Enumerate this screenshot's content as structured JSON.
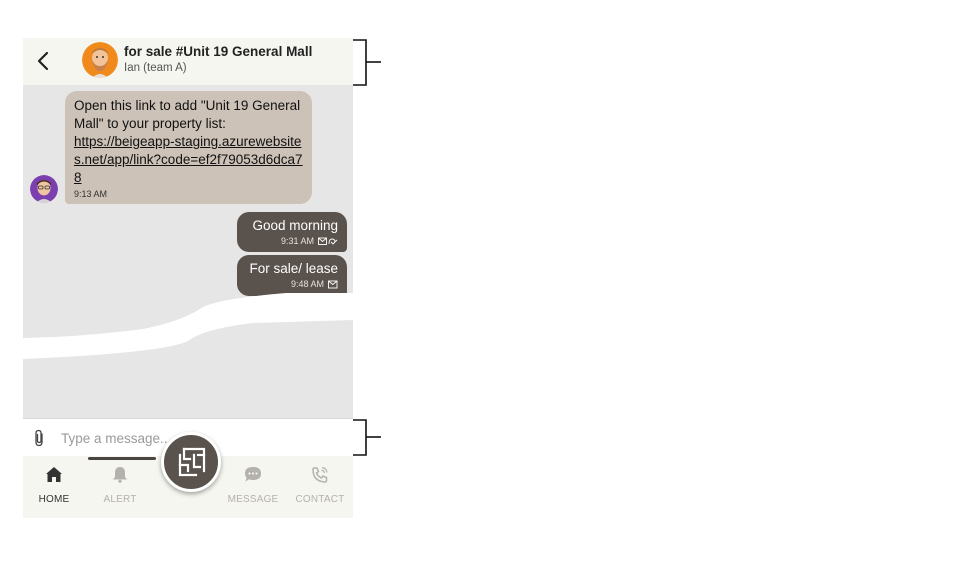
{
  "header": {
    "title": "for sale #Unit 19 General Mall",
    "subtitle": "Ian (team A)",
    "back_icon": "chevron-left-icon",
    "avatar_icon": "man-beard-avatar"
  },
  "messages": [
    {
      "direction": "incoming",
      "text": "Open this link to add \"Unit 19 General Mall\" to your property list:",
      "link": "https://beigeapp-staging.azurewebsites.net/app/link?code=ef2f79053d6dca78",
      "time": "9:13 AM",
      "avatar_icon": "man-glasses-avatar"
    },
    {
      "direction": "outgoing",
      "text": "Good morning",
      "time": "9:31 AM",
      "status_icon": "read-icon"
    },
    {
      "direction": "outgoing",
      "text": "For sale/ lease",
      "time": "9:48 AM",
      "status_icon": "sent-icon"
    }
  ],
  "composer": {
    "placeholder": "Type a message...",
    "attach_icon": "paperclip-icon"
  },
  "nav": {
    "items": [
      {
        "label": "HOME",
        "icon": "home-icon",
        "active": true
      },
      {
        "label": "ALERT",
        "icon": "bell-icon",
        "active": false
      },
      {
        "label": "MESSAGE",
        "icon": "chat-icon",
        "active": false
      },
      {
        "label": "CONTACT",
        "icon": "phone-icon",
        "active": false
      }
    ],
    "center_button_icon": "floorplan-icon"
  },
  "colors": {
    "incoming_bubble": "#cdc2b7",
    "outgoing_bubble": "#5a524c",
    "chat_background": "#e6e6e6",
    "header_background": "#f6f6f0",
    "nav_active": "#333333",
    "nav_inactive": "#b5b1ad"
  }
}
